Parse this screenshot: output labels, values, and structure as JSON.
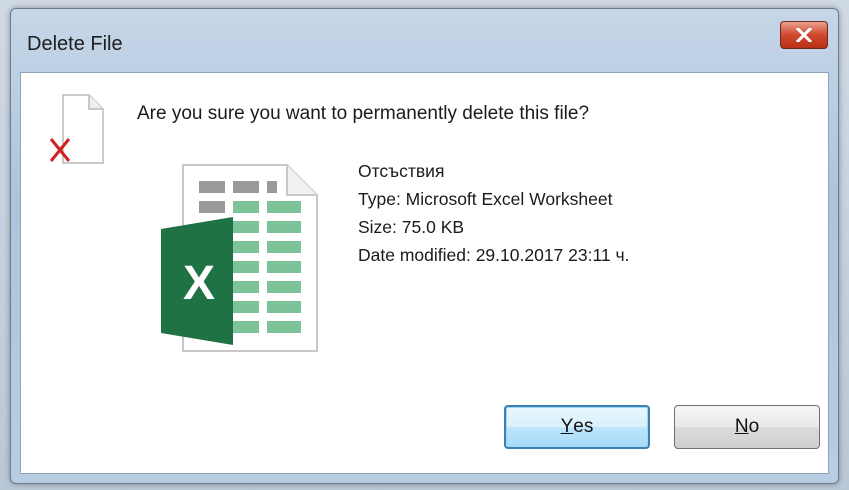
{
  "dialog": {
    "title": "Delete File",
    "question": "Are you sure you want to permanently delete this file?"
  },
  "file": {
    "name": "Отсъствия",
    "type": "Type: Microsoft Excel Worksheet",
    "size": "Size: 75.0 KB",
    "date_modified": "Date modified: 29.10.2017 23:11 ч.",
    "icon_letter": "X"
  },
  "buttons": {
    "yes_first": "Y",
    "yes_rest": "es",
    "no_first": "N",
    "no_rest": "o"
  },
  "colors": {
    "excel_green": "#1f7244",
    "excel_light_green": "#7cc39a",
    "close_red": "#c8432a",
    "delete_x_red": "#d42020"
  },
  "icons": {
    "close": "close-icon",
    "deleted_file": "file-delete-icon",
    "excel": "excel-file-icon"
  }
}
